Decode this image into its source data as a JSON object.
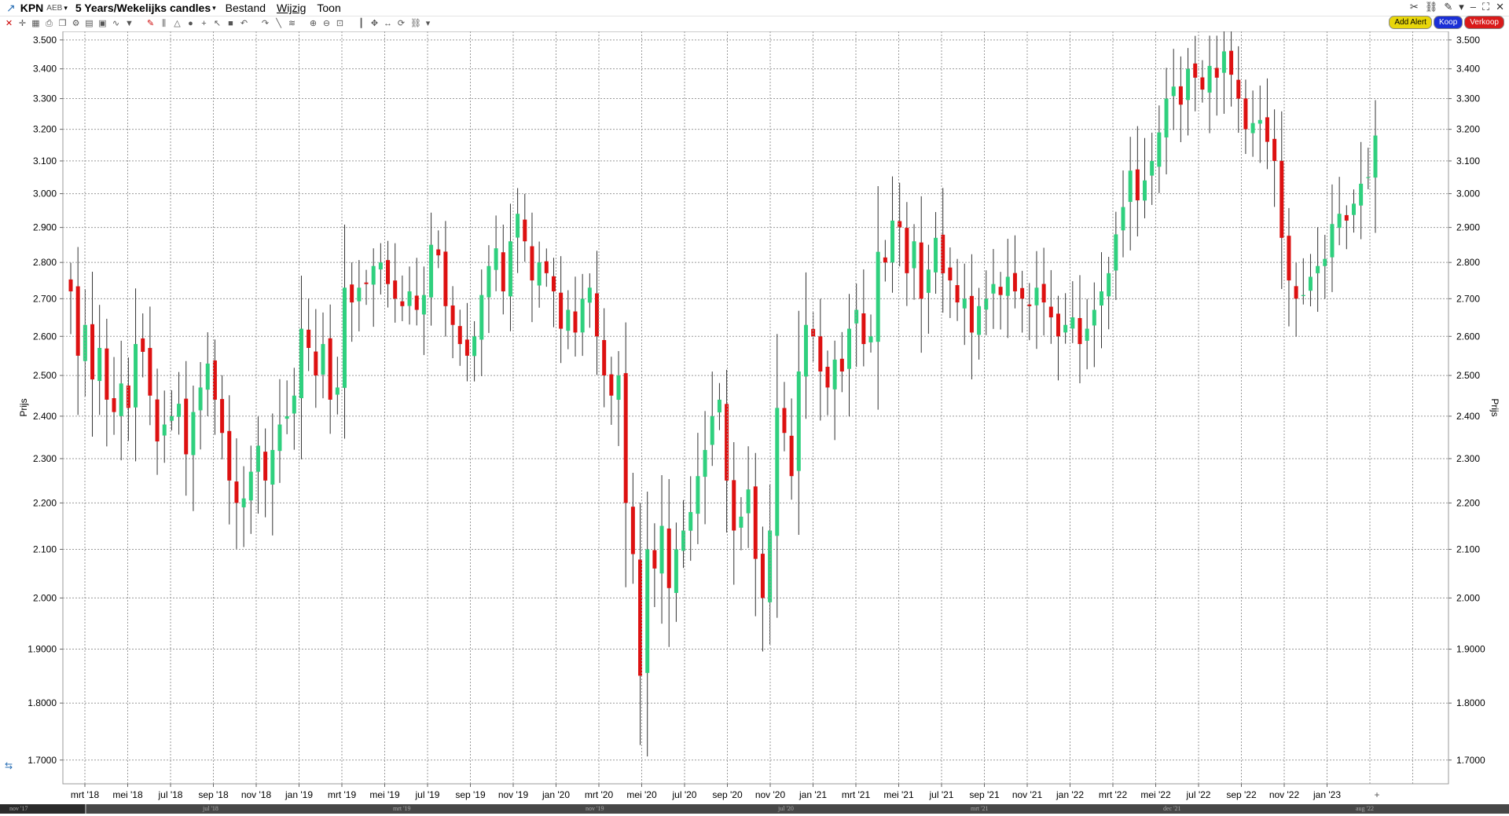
{
  "header": {
    "symbol": "KPN",
    "exchange": "AEB",
    "period": "5 Years/Wekelijks candles",
    "menu": [
      "Bestand",
      "Wijzig",
      "Toon"
    ]
  },
  "actions": {
    "alert": "Add Alert",
    "buy": "Koop",
    "sell": "Verkoop"
  },
  "colors": {
    "up": "#2fd07e",
    "down": "#dd1111",
    "wick": "#333333",
    "grid": "#9a9a9a"
  },
  "toolbar_icons": [
    "close-icon",
    "crosshair-icon",
    "grid-icon",
    "print-icon",
    "copy-icon",
    "settings-icon",
    "template-icon",
    "layout-icon",
    "indicator-icon",
    "arrow-down-icon",
    "pen-icon",
    "bars-icon",
    "shape-icon",
    "circle-icon",
    "cross-icon",
    "cursor-icon",
    "box-icon",
    "undo-icon",
    "redo-icon",
    "line-icon",
    "fib-icon",
    "zoom-in-icon",
    "zoom-out-icon",
    "zoom-fit-icon",
    "candle-icon",
    "pan-icon",
    "scroll-icon",
    "refresh-icon",
    "link-icon",
    "more-icon"
  ],
  "navigator": {
    "labels": [
      "nov '17",
      "jul '18",
      "mrt '19",
      "nov '19",
      "jul '20",
      "mrt '21",
      "dec '21",
      "aug '22"
    ]
  },
  "chart_data": {
    "type": "candlestick",
    "title": "",
    "ylabel": "Prijs",
    "ylim": [
      1.66,
      3.53
    ],
    "yscale": "log",
    "yticks": [
      3.5,
      3.4,
      3.3,
      3.2,
      3.1,
      3.0,
      2.9,
      2.8,
      2.7,
      2.6,
      2.5,
      2.4,
      2.3,
      2.2,
      2.1,
      2.0,
      1.9,
      1.8,
      1.7
    ],
    "ytick_labels": [
      "3.500",
      "3.400",
      "3.300",
      "3.200",
      "3.100",
      "3.000",
      "2.900",
      "2.800",
      "2.700",
      "2.600",
      "2.500",
      "2.400",
      "2.300",
      "2.200",
      "2.100",
      "2.000",
      "1.9000",
      "1.8000",
      "1.7000"
    ],
    "xtick_labels": [
      "mrt '18",
      "mei '18",
      "jul '18",
      "sep '18",
      "nov '18",
      "jan '19",
      "mrt '19",
      "mei '19",
      "jul '19",
      "sep '19",
      "nov '19",
      "jan '20",
      "mrt '20",
      "mei '20",
      "jul '20",
      "sep '20",
      "nov '20",
      "jan '21",
      "mrt '21",
      "mei '21",
      "jul '21",
      "sep '21",
      "nov '21",
      "jan '22",
      "mrt '22",
      "mei '22",
      "jul '22",
      "sep '22",
      "nov '22",
      "jan '23"
    ],
    "grid": true,
    "legend": "none",
    "x_first_week": "2018-02-19",
    "weekly_close": [
      2.72,
      2.55,
      2.63,
      2.49,
      2.57,
      2.44,
      2.41,
      2.48,
      2.42,
      2.58,
      2.56,
      2.45,
      2.34,
      2.38,
      2.4,
      2.43,
      2.31,
      2.41,
      2.47,
      2.53,
      2.44,
      2.36,
      2.25,
      2.2,
      2.21,
      2.27,
      2.33,
      2.25,
      2.32,
      2.38,
      2.4,
      2.45,
      2.62,
      2.57,
      2.5,
      2.58,
      2.44,
      2.47,
      2.73,
      2.69,
      2.73,
      2.74,
      2.79,
      2.8,
      2.74,
      2.7,
      2.68,
      2.72,
      2.67,
      2.71,
      2.85,
      2.82,
      2.68,
      2.63,
      2.58,
      2.55,
      2.6,
      2.71,
      2.79,
      2.84,
      2.72,
      2.86,
      2.94,
      2.86,
      2.75,
      2.8,
      2.77,
      2.72,
      2.62,
      2.67,
      2.61,
      2.7,
      2.73,
      2.6,
      2.5,
      2.45,
      2.5,
      2.2,
      2.09,
      1.85,
      2.1,
      2.06,
      2.15,
      2.02,
      2.1,
      2.14,
      2.18,
      2.26,
      2.32,
      2.4,
      2.44,
      2.25,
      2.14,
      2.17,
      2.23,
      2.08,
      2.0,
      2.14,
      2.42,
      2.36,
      2.26,
      2.51,
      2.63,
      2.6,
      2.51,
      2.47,
      2.54,
      2.51,
      2.62,
      2.67,
      2.58,
      2.6,
      2.83,
      2.8,
      2.92,
      2.9,
      2.77,
      2.86,
      2.7,
      2.78,
      2.87,
      2.77,
      2.75,
      2.69,
      2.7,
      2.61,
      2.68,
      2.7,
      2.74,
      2.71,
      2.76,
      2.72,
      2.7,
      2.68,
      2.73,
      2.69,
      2.65,
      2.6,
      2.63,
      2.65,
      2.58,
      2.62,
      2.67,
      2.72,
      2.77,
      2.88,
      2.96,
      3.07,
      2.98,
      3.04,
      3.1,
      3.19,
      3.3,
      3.34,
      3.28,
      3.4,
      3.37,
      3.33,
      3.41,
      3.37,
      3.46,
      3.38,
      3.3,
      3.2,
      3.22,
      3.23,
      3.16,
      3.1,
      2.87,
      2.75,
      2.7,
      2.71,
      2.76,
      2.79,
      2.81,
      2.91,
      2.94,
      2.92,
      2.97,
      3.03,
      3.05,
      3.18
    ]
  }
}
